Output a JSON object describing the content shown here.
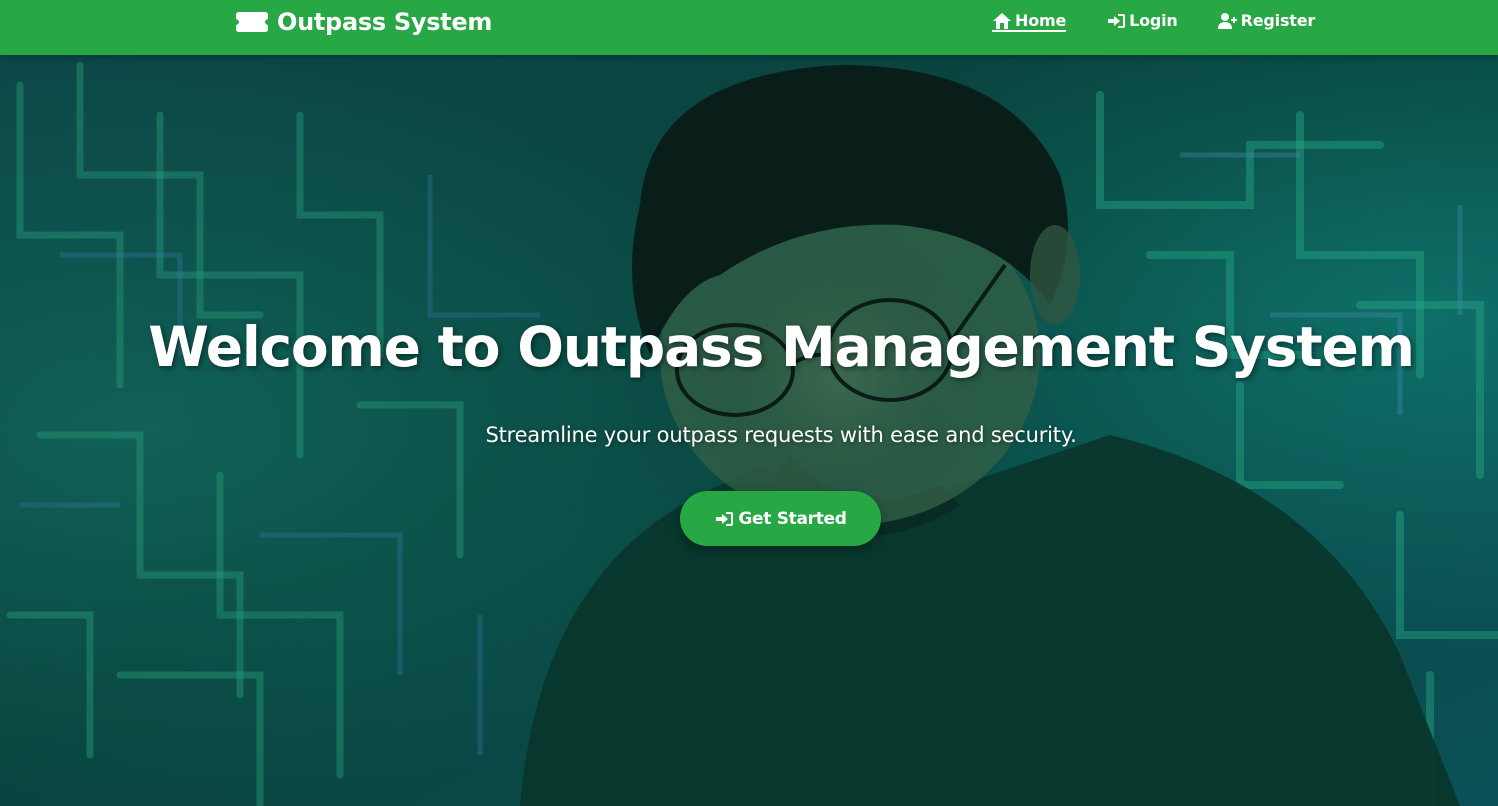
{
  "navbar": {
    "brand": {
      "icon": "ticket-icon",
      "text": "Outpass System"
    },
    "links": [
      {
        "label": "Home",
        "icon": "home-icon",
        "active": true
      },
      {
        "label": "Login",
        "icon": "sign-in-icon",
        "active": false
      },
      {
        "label": "Register",
        "icon": "user-plus-icon",
        "active": false
      }
    ]
  },
  "hero": {
    "title": "Welcome to Outpass Management System",
    "subtitle": "Streamline your outpass requests with ease and security.",
    "cta": {
      "label": "Get Started",
      "icon": "sign-in-icon"
    },
    "background_image": "person-with-glasses-circuit-board-background"
  },
  "colors": {
    "primary": "#28a745",
    "text_on_primary": "#ffffff",
    "hero_tint": "#0b3f3a"
  }
}
